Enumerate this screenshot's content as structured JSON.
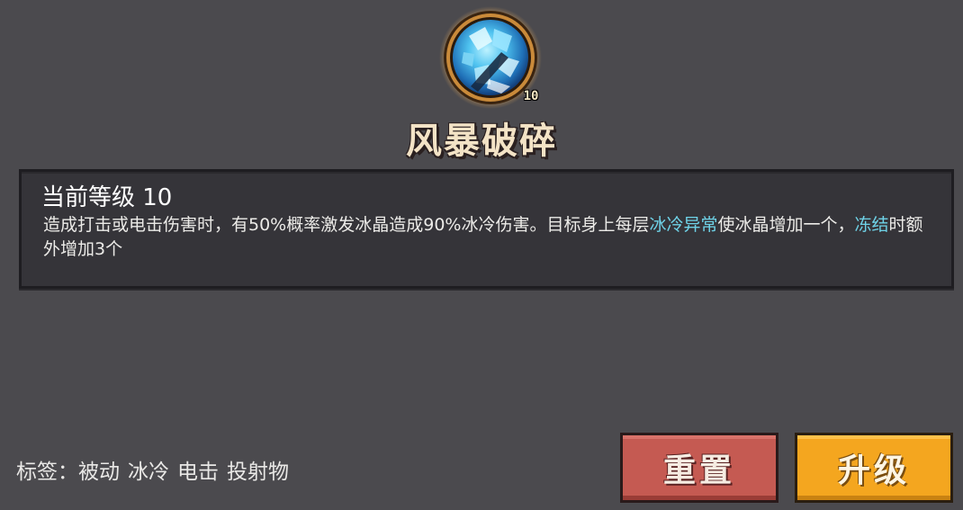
{
  "skill": {
    "name": "风暴破碎",
    "level_badge": "10",
    "icon": "ice-crystal-orb-icon"
  },
  "panel": {
    "level_label": "当前等级 10",
    "desc_segments": [
      {
        "text": "造成打击或电击伤害时，有50%概率激发冰晶造成90%冰冷伤害。目标身上每层",
        "highlight": false
      },
      {
        "text": "冰冷异常",
        "highlight": true
      },
      {
        "text": "使冰晶增加一个，",
        "highlight": false
      },
      {
        "text": "冻结",
        "highlight": true
      },
      {
        "text": "时额外增加3个",
        "highlight": false
      }
    ]
  },
  "tags": {
    "label": "标签：",
    "items": [
      "被动",
      "冰冷",
      "电击",
      "投射物"
    ]
  },
  "buttons": {
    "reset": "重置",
    "upgrade": "升级"
  },
  "colors": {
    "background": "#4b4a4e",
    "panel": "#353439",
    "keyword": "#6fd3e8",
    "reset_button": "#c55a52",
    "upgrade_button": "#f4a61f",
    "title": "#f3e3c6"
  }
}
